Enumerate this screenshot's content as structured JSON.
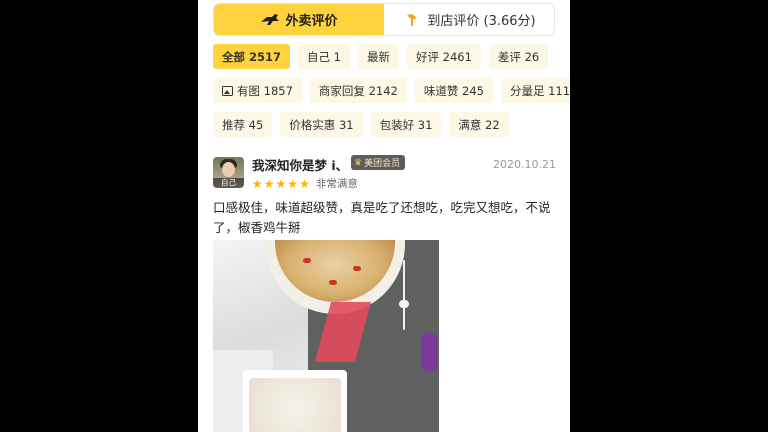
{
  "tabs": [
    {
      "label": "外卖评价",
      "icon": "delivery-rider-icon",
      "active": true
    },
    {
      "label": "到店评价 (3.66分)",
      "icon": "shop-pin-icon",
      "active": false
    }
  ],
  "filters": [
    [
      {
        "label": "全部 2517",
        "active": true
      },
      {
        "label": "自己 1"
      },
      {
        "label": "最新"
      },
      {
        "label": "好评 2461"
      },
      {
        "label": "差评 26"
      }
    ],
    [
      {
        "label": "有图 1857",
        "icon": "image-icon"
      },
      {
        "label": "商家回复 2142"
      },
      {
        "label": "味道赞 245"
      },
      {
        "label": "分量足 111"
      }
    ],
    [
      {
        "label": "推荐 45"
      },
      {
        "label": "价格实惠 31"
      },
      {
        "label": "包装好 31"
      },
      {
        "label": "满意 22"
      }
    ]
  ],
  "review": {
    "avatar_tag": "自己",
    "username": "我深知你是梦 i、",
    "member_badge": "美团会员",
    "date": "2020.10.21",
    "stars": 5,
    "rating_text": "非常满意",
    "text": "口感极佳，味道超级赞，真是吃了还想吃，吃完又想吃，不说了，椒香鸡牛掰",
    "photo_icon": "food-photo"
  },
  "colors": {
    "accent": "#ffd33d",
    "chip_bg": "#fdf8e6",
    "star": "#ffb400"
  }
}
